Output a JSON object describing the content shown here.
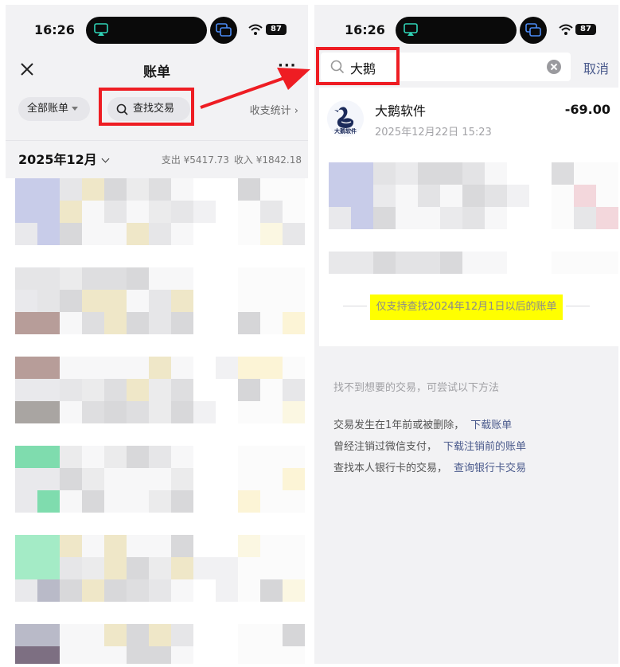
{
  "left": {
    "status": {
      "time": "16:26",
      "battery": "87"
    },
    "nav": {
      "title": "账单"
    },
    "filters": {
      "all_accounts": "全部账单",
      "search_label": "查找交易",
      "stats_link": "收支统计 ›"
    },
    "month": {
      "label": "2025年12月",
      "expense": "支出 ¥5417.73",
      "income": "收入 ¥1842.18"
    }
  },
  "right": {
    "status": {
      "time": "16:26",
      "battery": "87"
    },
    "search": {
      "value": "大鹅",
      "cancel": "取消"
    },
    "result": {
      "logo_text": "大鹅软件",
      "merchant": "大鹅软件",
      "datetime": "2025年12月22日 15:23",
      "amount": "-69.00"
    },
    "notice": "仅支持查找2024年12月1日以后的账单",
    "help": {
      "title": "找不到想要的交易，可尝试以下方法",
      "lines": [
        {
          "text": "交易发生在1年前或被删除，",
          "link": "下载账单"
        },
        {
          "text": "曾经注销过微信支付，",
          "link": "下载注销前的账单"
        },
        {
          "text": "查找本人银行卡的交易，",
          "link": "查询银行卡交易"
        }
      ]
    }
  },
  "colors": {
    "highlight": "#ffff00",
    "annotation_red": "#ee1d23",
    "link": "#4a5a8c"
  }
}
